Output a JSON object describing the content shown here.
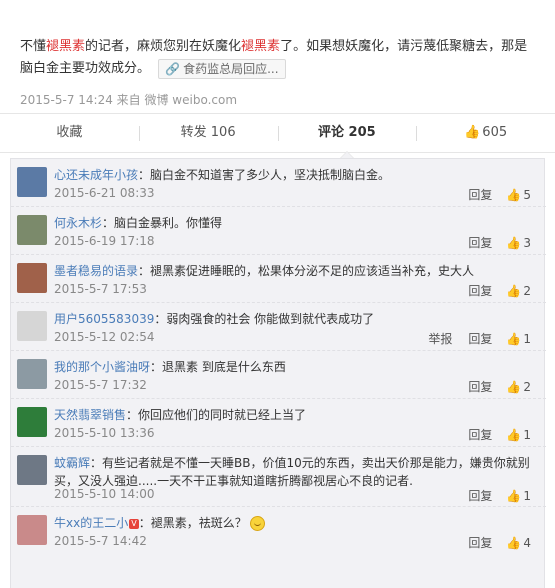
{
  "post": {
    "text_parts": [
      {
        "t": "不懂",
        "hl": false
      },
      {
        "t": "褪黑素",
        "hl": true
      },
      {
        "t": "的记者，麻烦您别在妖魔化",
        "hl": false
      },
      {
        "t": "褪黑素",
        "hl": true
      },
      {
        "t": "了。如果想妖魔化，请污蔑低聚糖去，那是脑白金主要功效成分。",
        "hl": false
      }
    ],
    "link_card": "食药监总局回应...",
    "meta": "2015-5-7 14:24 来自 微博 weibo.com"
  },
  "actions": {
    "collect": "收藏",
    "repost": "转发 106",
    "comment": "评论 205",
    "like": "605"
  },
  "comments": [
    {
      "user": "心还未成年小孩",
      "text": "：脑白金不知道害了多少人，坚决抵制脑白金。",
      "time": "2015-6-21 08:33",
      "reply": "回复",
      "likes": "5",
      "avatar_color": "#5b7aa5"
    },
    {
      "user": "何永木杉",
      "text": "：脑白金暴利。你懂得",
      "time": "2015-6-19 17:18",
      "reply": "回复",
      "likes": "3",
      "avatar_color": "#7b8a6b"
    },
    {
      "user": "墨者稳易的语录",
      "text": "：褪黑素促进睡眠的，松果体分泌不足的应该适当补充，史大人",
      "time": "2015-5-7 17:53",
      "reply": "回复",
      "likes": "2",
      "avatar_color": "#a0614a"
    },
    {
      "user": "用户5605583039",
      "text": "：弱肉强食的社会 你能做到就代表成功了",
      "time": "2015-5-12 02:54",
      "report": "举报",
      "reply": "回复",
      "likes": "1",
      "avatar_color": "#d6d6d6"
    },
    {
      "user": "我的那个小酱油呀",
      "text": "：退黑素 到底是什么东西",
      "time": "2015-5-7 17:32",
      "reply": "回复",
      "likes": "2",
      "avatar_color": "#8c9aa3"
    },
    {
      "user": "天然翡翠销售",
      "text": "：你回应他们的同时就已经上当了",
      "time": "2015-5-10 13:36",
      "reply": "回复",
      "likes": "1",
      "avatar_color": "#2e7d3a"
    },
    {
      "user": "蚊霸辉",
      "text": "：有些记者就是不懂一天睡BB，价值10元的东西，卖出天价那是能力，嫌贵你就别买，又没人强迫.....一天不干正事就知道瞎折腾鄙视居心不良的记者.",
      "time": "2015-5-10 14:00",
      "reply": "回复",
      "likes": "1",
      "avatar_color": "#6e7885"
    },
    {
      "user": "牛xx的王二小",
      "vip": "V",
      "text": "：褪黑素，祛斑么？",
      "time": "2015-5-7 14:42",
      "reply": "回复",
      "likes": "4",
      "avatar_color": "#c98a8a"
    }
  ]
}
